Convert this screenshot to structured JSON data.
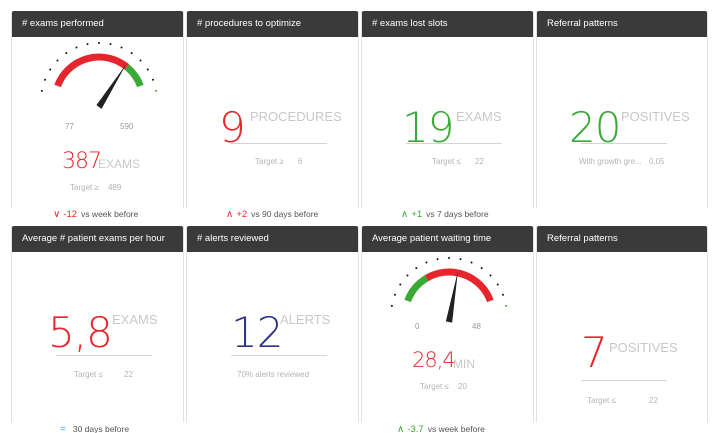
{
  "colors": {
    "red": "#e5272d",
    "green": "#3aaa35",
    "navy": "#2f3584",
    "blue": "#36a9e1",
    "header_bg": "#3a3a3a"
  },
  "tiles": [
    {
      "title": "# exams performed",
      "gauge": {
        "min_label": "77",
        "max_label": "590",
        "needle_fraction": 0.76
      },
      "value": "387",
      "unit": "EXAMS",
      "target_label": "Target ≥",
      "target_value": "489",
      "footer": {
        "arrow_icon": "chevron-down-icon",
        "arrow": "∨",
        "delta": "-12",
        "text": "vs week before"
      }
    },
    {
      "title": "# procedures to optimize",
      "value": "9",
      "unit": "PROCEDURES",
      "target_label": "Target ≥",
      "target_value": "6",
      "footer": {
        "arrow_icon": "chevron-up-icon",
        "arrow": "∧",
        "delta": "+2",
        "text": "vs 90 days before"
      }
    },
    {
      "title": "# exams lost slots",
      "value": "19",
      "unit": "EXAMS",
      "target_label": "Target ≤",
      "target_value": "22",
      "footer": {
        "arrow_icon": "chevron-up-icon",
        "arrow": "∧",
        "delta": "+1",
        "text": "vs 7 days before"
      }
    },
    {
      "title": "Referral patterns",
      "value": "20",
      "unit": "POSITIVES",
      "target_label": "With growth gre...",
      "target_value": "0,05"
    },
    {
      "title": "Average # patient exams per hour",
      "value": "5,8",
      "unit": "EXAMS",
      "target_label": "Target ≤",
      "target_value": "22",
      "footer": {
        "arrow_icon": "equals-icon",
        "arrow": "=",
        "delta": "",
        "text": "30 days before"
      }
    },
    {
      "title": "# alerts reviewed",
      "value": "12",
      "unit": "ALERTS",
      "target_label": "70% alerts reviewed",
      "target_value": ""
    },
    {
      "title": "Average patient waiting time",
      "gauge": {
        "min_label": "0",
        "max_label": "48",
        "needle_fraction": 0.58
      },
      "value": "28,4",
      "unit": "MIN",
      "target_label": "Target ≤",
      "target_value": "20",
      "footer": {
        "arrow_icon": "chevron-up-icon",
        "arrow": "∧",
        "delta": "-3.7",
        "text": "vs week before"
      }
    },
    {
      "title": "Referral patterns",
      "value": "7",
      "unit": "POSITIVES",
      "target_label": "Target ≤",
      "target_value": "22"
    }
  ]
}
